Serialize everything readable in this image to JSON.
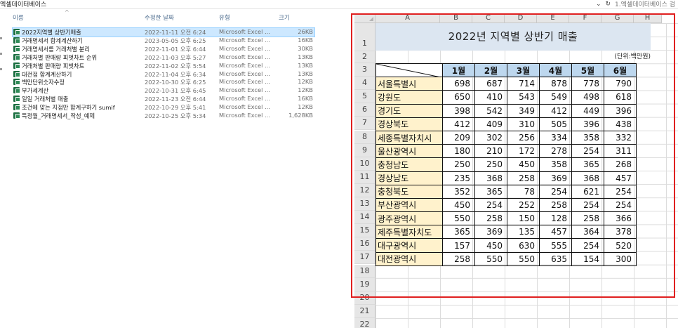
{
  "window": {
    "path_label": "엑셀데이터베이스",
    "search_placeholder": "1.엑셀데이터베이스 검",
    "refresh_glyph": "↻",
    "dropdown_glyph": "⌄"
  },
  "explorer": {
    "columns": {
      "name": "이름",
      "date": "수정한 날짜",
      "type": "유형",
      "size": "크기",
      "sort_glyph": "^"
    },
    "files": [
      {
        "name": "2022지역별 상반기매출",
        "date": "2022-11-11 오전 6:24",
        "type": "Microsoft Excel ...",
        "size": "26KB",
        "selected": true
      },
      {
        "name": "거래명세서 합계계산하기",
        "date": "2023-05-05 오후 6:25",
        "type": "Microsoft Excel ...",
        "size": "16KB"
      },
      {
        "name": "거래명세서를 거래처별 분리",
        "date": "2022-11-01 오후 6:44",
        "type": "Microsoft Excel ...",
        "size": "30KB"
      },
      {
        "name": "거래처별 판매량 피벗차트 순위",
        "date": "2022-11-03 오후 5:27",
        "type": "Microsoft Excel ...",
        "size": "13KB"
      },
      {
        "name": "거래처별 판매량 피벗차트",
        "date": "2022-11-02 오후 5:54",
        "type": "Microsoft Excel ...",
        "size": "13KB"
      },
      {
        "name": "대전점 합계계산하기",
        "date": "2022-11-04 오후 6:34",
        "type": "Microsoft Excel ...",
        "size": "13KB"
      },
      {
        "name": "백만단위숫자수정",
        "date": "2022-10-30 오후 6:25",
        "type": "Microsoft Excel ...",
        "size": "12KB"
      },
      {
        "name": "부가세계산",
        "date": "2022-10-31 오후 6:45",
        "type": "Microsoft Excel ...",
        "size": "12KB"
      },
      {
        "name": "일일 거래처별 매출",
        "date": "2022-11-23 오전 6:44",
        "type": "Microsoft Excel ...",
        "size": "16KB"
      },
      {
        "name": "조건에 맞는 지점만 합계구하기 sumif",
        "date": "2022-10-29 오후 5:41",
        "type": "Microsoft Excel ...",
        "size": "12KB"
      },
      {
        "name": "특정월_거래명세서_작성_예제",
        "date": "2022-10-25 오후 5:34",
        "type": "Microsoft Excel ...",
        "size": "1,628KB"
      }
    ]
  },
  "sheet": {
    "column_letters": [
      "A",
      "B",
      "C",
      "D",
      "E",
      "F",
      "G",
      "H"
    ],
    "row_numbers": [
      "1",
      "2",
      "3",
      "4",
      "5",
      "6",
      "7",
      "8",
      "9",
      "10",
      "11",
      "12",
      "13",
      "14",
      "15",
      "16",
      "17",
      "18",
      "19",
      "20",
      "21",
      "22"
    ],
    "title": "2022년 지역별 상반기 매출",
    "unit": "(단위:백만원)",
    "months": [
      "1월",
      "2월",
      "3월",
      "4월",
      "5월",
      "6월"
    ],
    "regions": [
      {
        "name": "서울특별시",
        "values": [
          698,
          687,
          714,
          878,
          778,
          790
        ]
      },
      {
        "name": "강원도",
        "values": [
          650,
          410,
          543,
          549,
          498,
          618
        ]
      },
      {
        "name": "경기도",
        "values": [
          398,
          542,
          349,
          412,
          449,
          396
        ]
      },
      {
        "name": "경상북도",
        "values": [
          412,
          409,
          310,
          505,
          396,
          438
        ]
      },
      {
        "name": "세종특별자치시",
        "values": [
          209,
          302,
          256,
          334,
          358,
          332
        ]
      },
      {
        "name": "울산광역시",
        "values": [
          180,
          210,
          172,
          278,
          254,
          311
        ]
      },
      {
        "name": "충청남도",
        "values": [
          250,
          250,
          450,
          358,
          365,
          268
        ]
      },
      {
        "name": "경상남도",
        "values": [
          235,
          368,
          258,
          369,
          368,
          457
        ]
      },
      {
        "name": "충청북도",
        "values": [
          352,
          365,
          78,
          254,
          621,
          254
        ]
      },
      {
        "name": "부산광역시",
        "values": [
          450,
          254,
          252,
          258,
          254,
          254
        ]
      },
      {
        "name": "광주광역시",
        "values": [
          550,
          258,
          150,
          128,
          258,
          366
        ]
      },
      {
        "name": "제주특별자치도",
        "values": [
          365,
          369,
          135,
          457,
          364,
          378
        ]
      },
      {
        "name": "대구광역시",
        "values": [
          157,
          450,
          630,
          555,
          254,
          520
        ]
      },
      {
        "name": "대전광역시",
        "values": [
          258,
          550,
          550,
          635,
          154,
          300
        ]
      }
    ]
  },
  "colors": {
    "highlight_box": "#e02020",
    "header_fill": "#bdd7ee",
    "region_fill": "#fff2cc",
    "title_fill": "#dce6f1"
  }
}
